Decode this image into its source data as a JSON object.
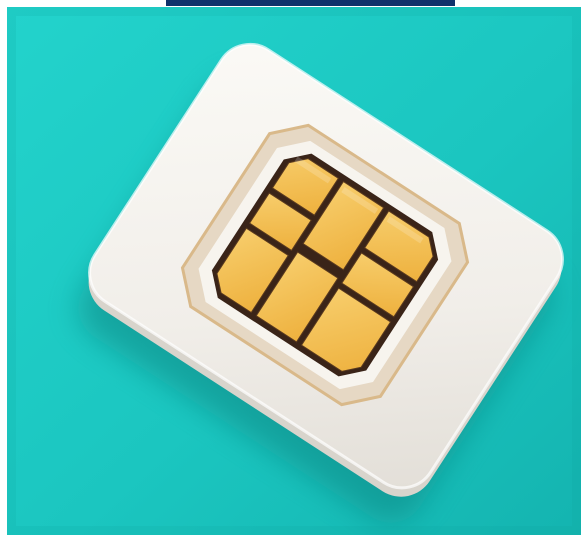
{
  "image": {
    "subject": "sim-card",
    "colors": {
      "background_teal": "#1ec9c3",
      "background_teal_dark": "#12a9a6",
      "card_white": "#f4f2ee",
      "card_shadow": "#0a8783",
      "chip_gold": "#f1b845",
      "chip_gold_light": "#f6c965",
      "chip_outline": "#3a2418",
      "top_bar_navy": "#10326b"
    }
  }
}
